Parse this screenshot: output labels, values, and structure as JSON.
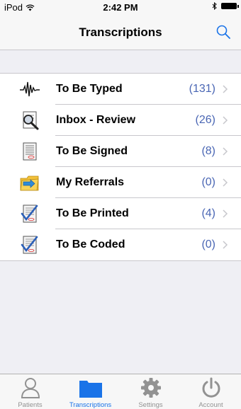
{
  "status_bar": {
    "device": "iPod",
    "time": "2:42 PM"
  },
  "nav": {
    "title": "Transcriptions"
  },
  "rows": [
    {
      "label": "To Be Typed",
      "count": "(131)",
      "icon": "waveform-icon"
    },
    {
      "label": "Inbox - Review",
      "count": "(26)",
      "icon": "magnifier-document-icon"
    },
    {
      "label": "To Be Signed",
      "count": "(8)",
      "icon": "signature-document-icon"
    },
    {
      "label": "My Referrals",
      "count": "(0)",
      "icon": "referral-folder-icon"
    },
    {
      "label": "To Be Printed",
      "count": "(4)",
      "icon": "checked-document-icon"
    },
    {
      "label": "To Be Coded",
      "count": "(0)",
      "icon": "checked-document-icon"
    }
  ],
  "tabs": [
    {
      "label": "Patients",
      "icon": "person-icon"
    },
    {
      "label": "Transcriptions",
      "icon": "folder-icon",
      "active": true
    },
    {
      "label": "Settings",
      "icon": "gear-icon"
    },
    {
      "label": "Account",
      "icon": "power-icon"
    }
  ],
  "colors": {
    "accent": "#1a73e8",
    "count": "#4a66b4",
    "background": "#efeff4"
  }
}
